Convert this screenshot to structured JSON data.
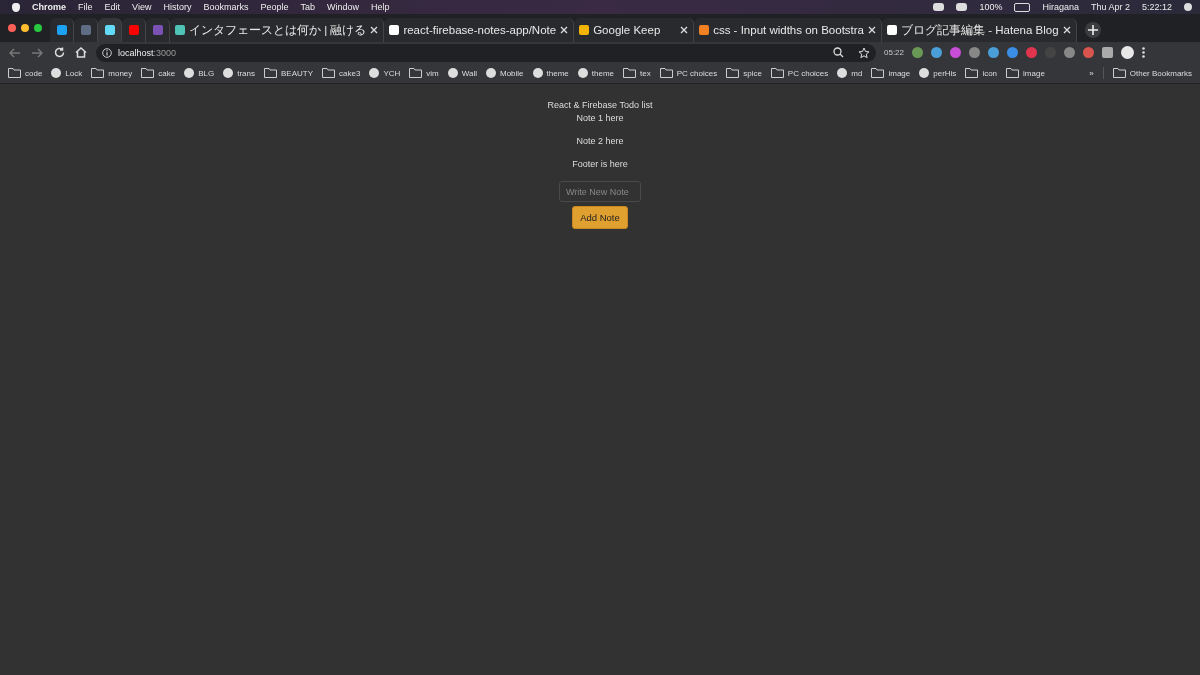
{
  "menu_bar": {
    "app": "Chrome",
    "menus": [
      "File",
      "Edit",
      "View",
      "History",
      "Bookmarks",
      "People",
      "Tab",
      "Window",
      "Help"
    ],
    "battery": "100%",
    "input_method": "Hiragana",
    "date": "Thu Apr 2",
    "time": "5:22:12"
  },
  "tabs": [
    {
      "kind": "pinned",
      "selected": false
    },
    {
      "kind": "pinned",
      "selected": false
    },
    {
      "kind": "pinned",
      "selected": true
    },
    {
      "kind": "pinned",
      "selected": false
    },
    {
      "kind": "pinned",
      "selected": false
    },
    {
      "kind": "normal",
      "title": "インタフェースとは何か | 融ける",
      "selected": false
    },
    {
      "kind": "normal",
      "title": "react-firebase-notes-app/Note",
      "selected": false
    },
    {
      "kind": "normal",
      "title": "Google Keep",
      "selected": false
    },
    {
      "kind": "normal",
      "title": "css - Input widths on Bootstra",
      "selected": false
    },
    {
      "kind": "normal",
      "title": "ブログ記事編集 - Hatena Blog",
      "selected": false
    }
  ],
  "address_bar": {
    "host": "localhost",
    "port": ":3000"
  },
  "extension_badge": "05:22",
  "bookmarks": [
    {
      "kind": "folder",
      "label": "code"
    },
    {
      "kind": "site",
      "label": "Lock"
    },
    {
      "kind": "folder",
      "label": "money"
    },
    {
      "kind": "folder",
      "label": "cake"
    },
    {
      "kind": "site",
      "label": "BLG"
    },
    {
      "kind": "site",
      "label": "trans"
    },
    {
      "kind": "folder",
      "label": "BEAUTY"
    },
    {
      "kind": "folder",
      "label": "cake3"
    },
    {
      "kind": "site",
      "label": "YCH"
    },
    {
      "kind": "folder",
      "label": "vim"
    },
    {
      "kind": "site",
      "label": "Wall"
    },
    {
      "kind": "site",
      "label": "Mobile"
    },
    {
      "kind": "site",
      "label": "theme"
    },
    {
      "kind": "site",
      "label": "theme"
    },
    {
      "kind": "folder",
      "label": "tex"
    },
    {
      "kind": "folder",
      "label": "PC choices"
    },
    {
      "kind": "folder",
      "label": "spice"
    },
    {
      "kind": "folder",
      "label": "PC choices"
    },
    {
      "kind": "site",
      "label": "md"
    },
    {
      "kind": "folder",
      "label": "image"
    },
    {
      "kind": "site",
      "label": "perHis"
    },
    {
      "kind": "folder",
      "label": "icon"
    },
    {
      "kind": "folder",
      "label": "image"
    }
  ],
  "overflow": "»",
  "other_bookmarks": "Other Bookmarks",
  "page": {
    "title": "React & Firebase Todo list",
    "notes": [
      "Note 1 here",
      "Note 2 here"
    ],
    "footer": "Footer is here",
    "input": {
      "placeholder": "Write New Note"
    },
    "button": "Add Note"
  }
}
